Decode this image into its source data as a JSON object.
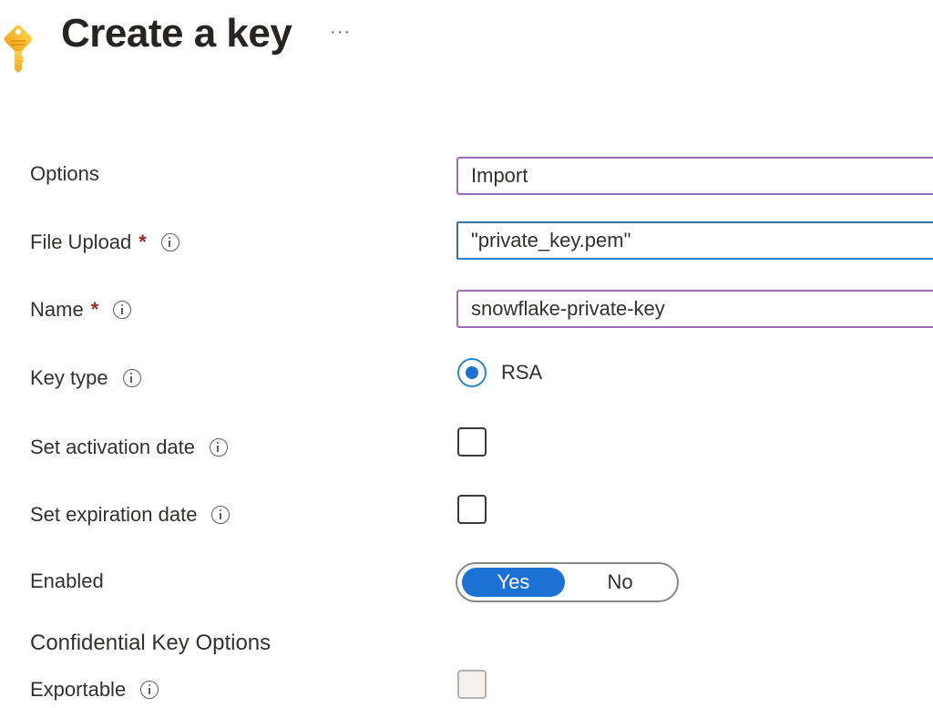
{
  "header": {
    "title": "Create a key",
    "more_icon": "ellipsis-icon",
    "more_label": "···",
    "page_icon": "key-icon"
  },
  "form": {
    "options": {
      "label": "Options",
      "value": "Import"
    },
    "file_upload": {
      "label": "File Upload",
      "required": "*",
      "value": "\"private_key.pem\""
    },
    "name": {
      "label": "Name",
      "required": "*",
      "value": "snowflake-private-key"
    },
    "key_type": {
      "label": "Key type",
      "selected": "RSA"
    },
    "activation_date": {
      "label": "Set activation date",
      "checked": false
    },
    "expiration_date": {
      "label": "Set expiration date",
      "checked": false
    },
    "enabled": {
      "label": "Enabled",
      "options": [
        "Yes",
        "No"
      ],
      "selected": "Yes"
    },
    "confidential_section": {
      "heading": "Confidential Key Options"
    },
    "exportable": {
      "label": "Exportable",
      "checked": false,
      "disabled": true
    }
  },
  "colors": {
    "accent": "#1c72d4",
    "required": "#a4262c",
    "input_border": "#9b6cb7",
    "key_icon": "#f5bb27"
  }
}
